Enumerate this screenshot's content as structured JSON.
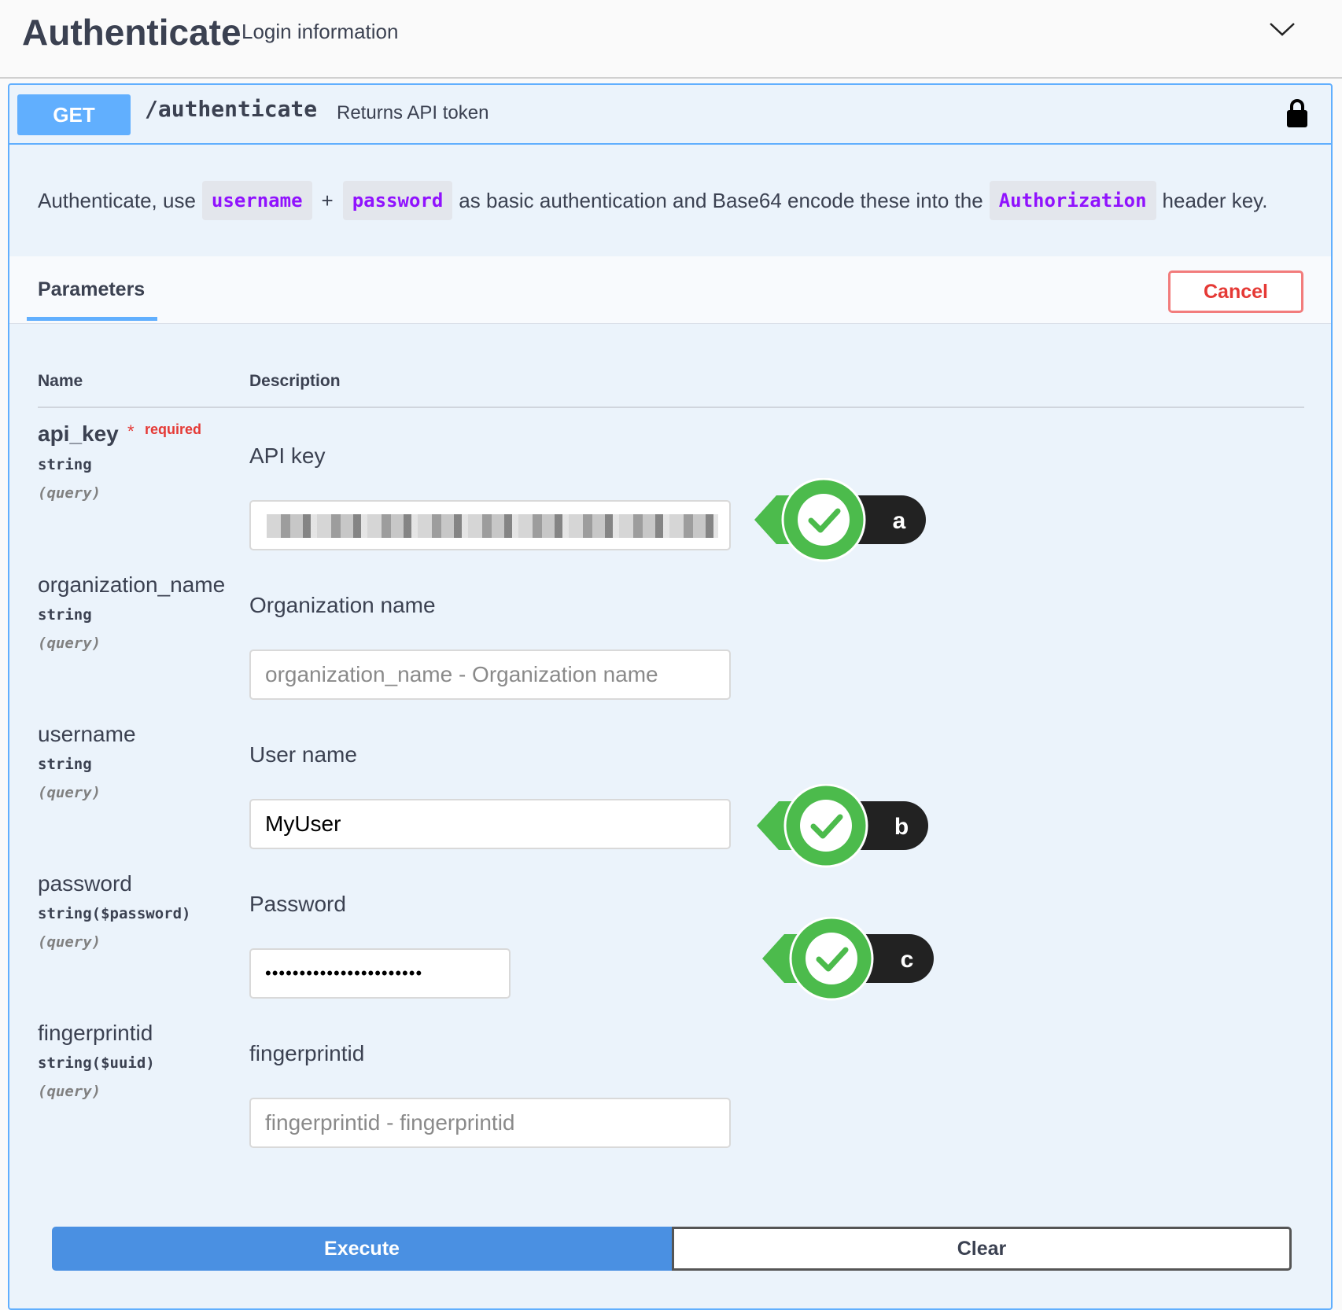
{
  "header": {
    "title": "Authenticate",
    "subtitle": "Login information"
  },
  "operation": {
    "method": "GET",
    "path": "/authenticate",
    "summary": "Returns API token",
    "description": {
      "prefix": "Authenticate, use",
      "code1": "username",
      "plus": "+",
      "code2": "password",
      "middle": "as basic authentication and Base64 encode these into the",
      "code3": "Authorization",
      "suffix": "header key."
    }
  },
  "tabs": {
    "parameters": "Parameters",
    "cancel": "Cancel"
  },
  "columns": {
    "name": "Name",
    "description": "Description"
  },
  "params": [
    {
      "name": "api_key",
      "required_star": "*",
      "required_text": "required",
      "type": "string",
      "in": "(query)",
      "description": "API key",
      "value": "",
      "placeholder": ""
    },
    {
      "name": "organization_name",
      "type": "string",
      "in": "(query)",
      "description": "Organization name",
      "value": "",
      "placeholder": "organization_name - Organization name"
    },
    {
      "name": "username",
      "type": "string",
      "in": "(query)",
      "description": "User name",
      "value": "MyUser",
      "placeholder": ""
    },
    {
      "name": "password",
      "type": "string($password)",
      "in": "(query)",
      "description": "Password",
      "value": "•••••••••••••••••••••••",
      "placeholder": ""
    },
    {
      "name": "fingerprintid",
      "type": "string($uuid)",
      "in": "(query)",
      "description": "fingerprintid",
      "value": "",
      "placeholder": "fingerprintid - fingerprintid"
    }
  ],
  "badges": {
    "a": "a",
    "b": "b",
    "c": "c"
  },
  "colors": {
    "get": "#61affe",
    "execute": "#4a90e2",
    "cancel": "#f27c7c",
    "code": "#9012fe",
    "badge_green": "#4cbb4c",
    "badge_dark": "#222222"
  },
  "actions": {
    "execute": "Execute",
    "clear": "Clear"
  }
}
